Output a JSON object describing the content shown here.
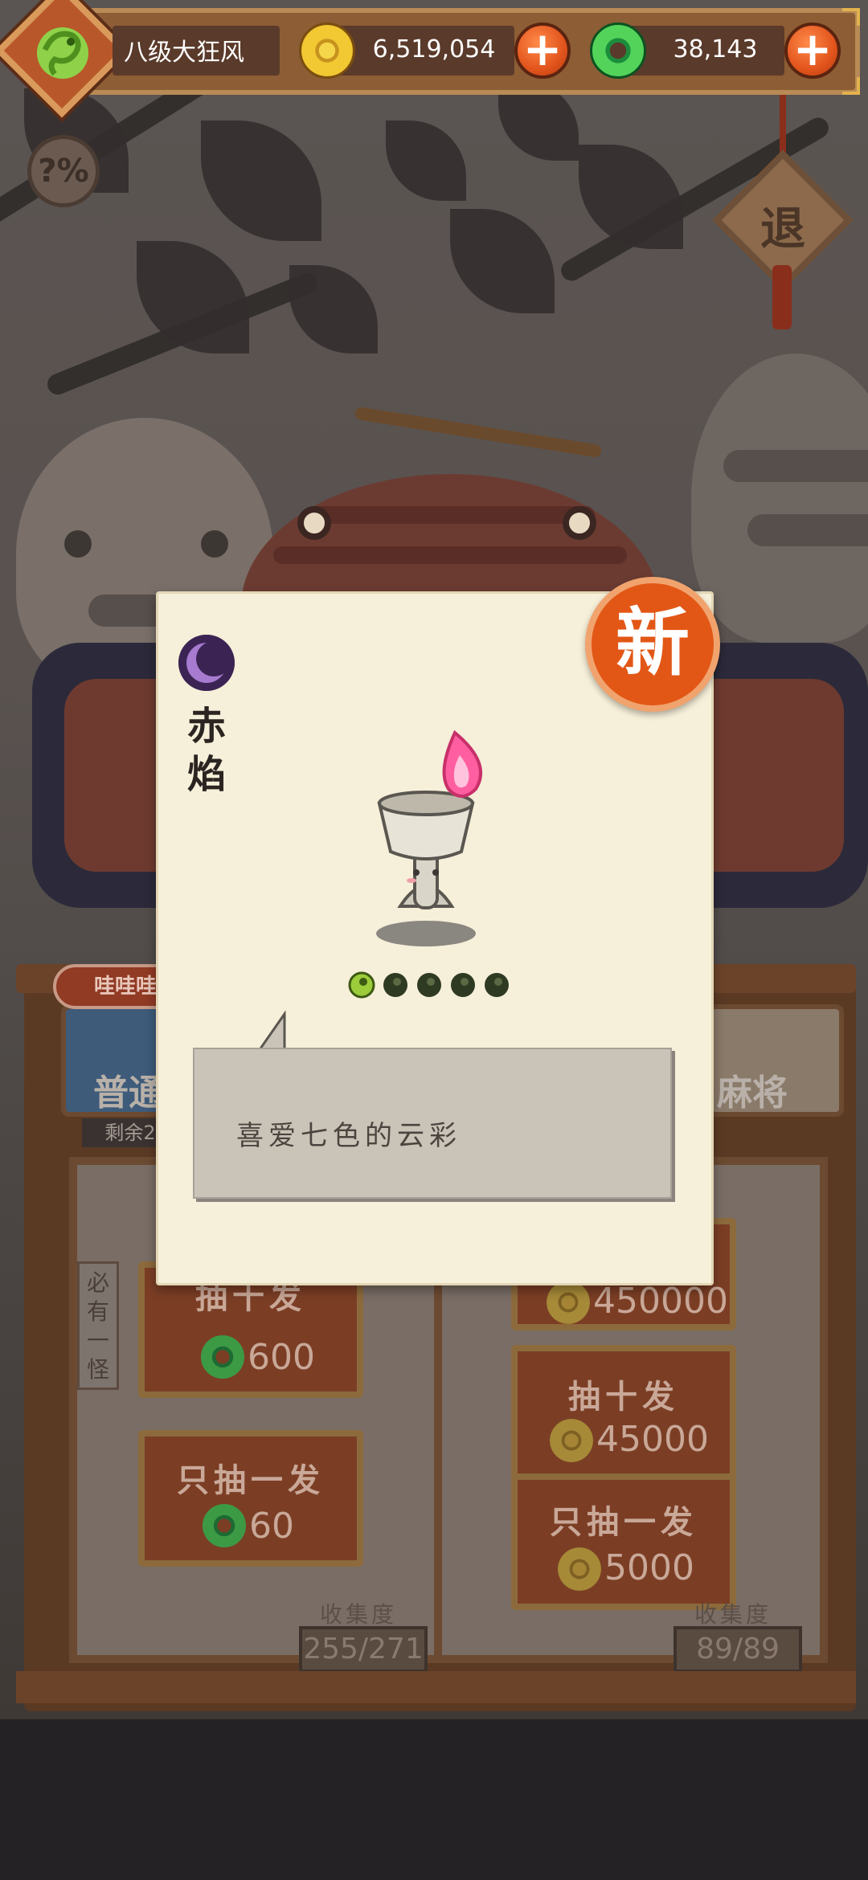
{
  "topbar": {
    "player_name": "八级大狂风",
    "gold_value": "6,519,054",
    "jade_value": "38,143",
    "plus_symbol": "+"
  },
  "hud": {
    "help_label": "?%",
    "exit_label": "退"
  },
  "shop": {
    "bubble_text": "哇哇哇",
    "left_tab_label": "普通",
    "left_remaining": "剩余2",
    "right_tab_label": "麻将",
    "banner_text": "必有一怪",
    "left_buttons": [
      {
        "label": "抽十发",
        "price": "600"
      },
      {
        "label": "只抽一发",
        "price": "60"
      }
    ],
    "right_buttons": [
      {
        "label": "",
        "price": "450000"
      },
      {
        "label": "抽十发",
        "price": "45000"
      },
      {
        "label": "只抽一发",
        "price": "5000"
      }
    ],
    "collection_label": "收集度",
    "left_collection": "255/271",
    "right_collection": "89/89"
  },
  "popup": {
    "new_badge": "新",
    "name": "赤焰",
    "description": "喜爱七色的云彩",
    "stars_filled": 1,
    "stars_total": 5
  },
  "colors": {
    "card_bg": "#f6efd9",
    "new_badge": "#e25716",
    "flame": "#ff5fa0",
    "accent_plus": "#e2541c"
  }
}
